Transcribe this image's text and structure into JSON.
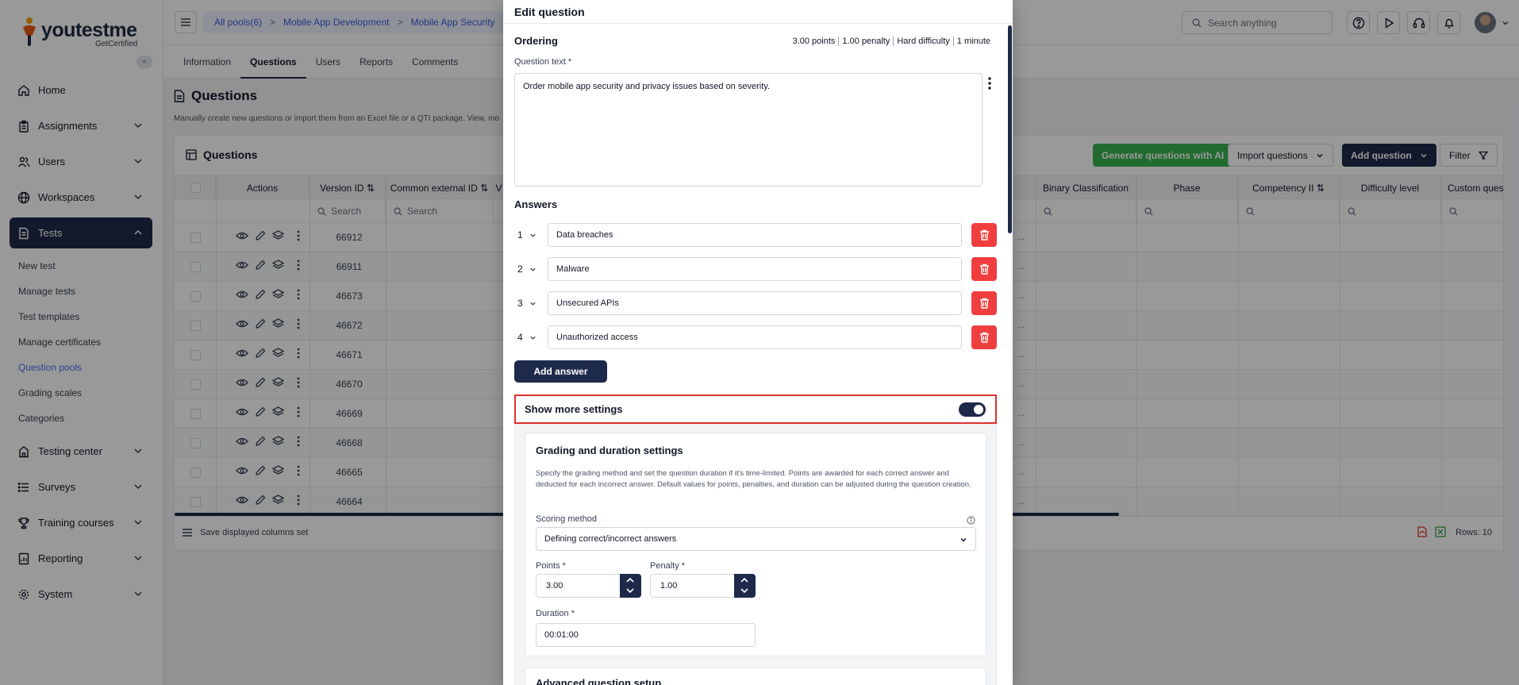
{
  "brand": {
    "name": "youtestme",
    "tagline": "GetCertified"
  },
  "sidebar": {
    "collapse_label": "«",
    "items": [
      {
        "label": "Home",
        "icon": "home-icon"
      },
      {
        "label": "Assignments",
        "icon": "clipboard-icon"
      },
      {
        "label": "Users",
        "icon": "users-icon"
      },
      {
        "label": "Workspaces",
        "icon": "globe-icon"
      },
      {
        "label": "Tests",
        "icon": "document-icon"
      }
    ],
    "tests_sub": [
      {
        "label": "New test"
      },
      {
        "label": "Manage tests"
      },
      {
        "label": "Test templates"
      },
      {
        "label": "Manage certificates"
      },
      {
        "label": "Question pools"
      },
      {
        "label": "Grading scales"
      },
      {
        "label": "Categories"
      }
    ],
    "items_after": [
      {
        "label": "Testing center",
        "icon": "building-icon"
      },
      {
        "label": "Surveys",
        "icon": "list-icon"
      },
      {
        "label": "Training courses",
        "icon": "trophy-icon"
      },
      {
        "label": "Reporting",
        "icon": "report-icon"
      },
      {
        "label": "System",
        "icon": "gear-icon"
      }
    ]
  },
  "topbar": {
    "breadcrumb": [
      "All pools(6)",
      "Mobile App Development",
      "Mobile App Security"
    ],
    "breadcrumb_sep": ">",
    "search_placeholder": "Search anything"
  },
  "tabs": [
    "Information",
    "Questions",
    "Users",
    "Reports",
    "Comments"
  ],
  "page": {
    "title": "Questions",
    "description": "Manually create new questions or import them from an Excel file or a QTI package. View, mo"
  },
  "grid": {
    "title": "Questions",
    "buttons": {
      "generate_ai": "Generate questions with AI",
      "import": "Import questions",
      "add": "Add question",
      "filter": "Filter"
    },
    "columns_left": [
      "Actions",
      "Version ID",
      "Common external ID",
      "V"
    ],
    "columns_right": [
      "Binary Classification",
      "Phase",
      "Competency II",
      "Difficulty level",
      "Custom quest"
    ],
    "filter_placeholder": "Search",
    "ids": [
      "66912",
      "66911",
      "46673",
      "46672",
      "46671",
      "46670",
      "46669",
      "46668",
      "46665",
      "46664"
    ],
    "footer_save": "Save displayed columns set",
    "rows_info": "Rows: 10",
    "ellipsis": "..."
  },
  "modal": {
    "title": "Edit question",
    "question_type": "Ordering",
    "meta": [
      "3.00 points",
      "1.00 penalty",
      "Hard difficulty",
      "1 minute"
    ],
    "question_text_label": "Question text *",
    "question_text": "Order mobile app security and privacy issues based on severity.",
    "answers_title": "Answers",
    "answers": [
      {
        "num": "1",
        "text": "Data breaches"
      },
      {
        "num": "2",
        "text": "Malware"
      },
      {
        "num": "3",
        "text": "Unsecured APIs"
      },
      {
        "num": "4",
        "text": "Unauthorized access"
      }
    ],
    "add_answer": "Add answer",
    "show_more_settings": "Show more settings",
    "show_more_settings_on": true,
    "grading": {
      "title": "Grading and duration settings",
      "description": "Specify the grading method and set the question duration if it's time-limited. Points are awarded for each correct answer and deducted for each incorrect answer. Default values for points, penalties, and duration can be adjusted during the question creation.",
      "scoring_label": "Scoring method",
      "scoring_value": "Defining correct/incorrect answers",
      "points_label": "Points *",
      "points_value": "3.00",
      "penalty_label": "Penalty *",
      "penalty_value": "1.00",
      "duration_label": "Duration *",
      "duration_value": "00:01:00"
    },
    "advanced_title": "Advanced question setup"
  },
  "colors": {
    "navy": "#1e2a4a",
    "green": "#37b24d",
    "red": "#f03e3e",
    "link": "#3b5bdb",
    "highlight": "#e03131"
  }
}
